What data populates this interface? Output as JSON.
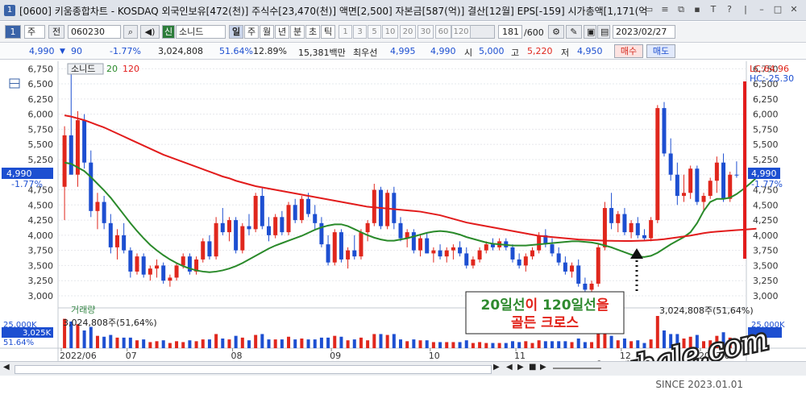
{
  "window": {
    "badge": "1",
    "title": "[0600] 키움종합차트 - KOSDAQ 외국인보유[472(천)] 주식수[23,470(천)] 액면[2,500] 자본금[587(억)] 결산[12월] EPS[-159] 시가총액[1,171(억",
    "buttons": [
      "▭",
      "≡",
      "⧉",
      "▪",
      "T",
      "?",
      "|",
      "–",
      "□",
      "✕"
    ]
  },
  "toolbar": {
    "badge": "1",
    "period_select": "주",
    "prev_label": "전",
    "stock_code": "060230",
    "market_tag": "신",
    "stock_name": "소니드",
    "timeframes": [
      "일",
      "주",
      "월",
      "년",
      "분",
      "초",
      "틱"
    ],
    "intervals": [
      "1",
      "3",
      "5",
      "10",
      "20",
      "30",
      "60",
      "120"
    ],
    "count": "181",
    "total": "/600",
    "date": "2023/02/27"
  },
  "quote": {
    "price": "4,990",
    "arrow": "▼",
    "change": "90",
    "change_pct": "-1.77%",
    "volume": "3,024,808",
    "ratio": "51.64%",
    "ratio2": "12.89%",
    "amount": "15,381백만",
    "best_label": "최우선",
    "best_ask": "4,995",
    "best_bid": "4,990",
    "open_label": "시",
    "open": "5,000",
    "high_label": "고",
    "high": "5,220",
    "low_label": "저",
    "low": "4,950",
    "buy_label": "매수",
    "sell_label": "매도"
  },
  "legend": {
    "name": "소니드",
    "ma20": "20",
    "ma120": "120"
  },
  "price_panel": {
    "lc_label": "LC:64.96",
    "hc_label": "HC:-25.30",
    "current_label": "4,990",
    "current_pct": "-1.77%",
    "volume_title": "거래량",
    "volume_text": "3,024,808주(51,64%)",
    "volume_text_right": "3,024,808주(51,64%)",
    "vol_left_box": "3,025K",
    "vol_left_pct": "51.64%",
    "vol_tick_top": "25,000K"
  },
  "annotation": {
    "line1_a": "20일선",
    "line1_b": "이 ",
    "line1_c": "120일선",
    "line1_d": "을",
    "line2": "골든 크로스"
  },
  "watermark": {
    "text": "i-whale.com",
    "since": "SINCE 2023.01.01"
  },
  "bottom_controls": [
    "◀",
    "▶",
    "◀",
    "▶",
    "■",
    "▶",
    "▶"
  ],
  "colors": {
    "up": "#e0271d",
    "down": "#1d4fd1",
    "ma20": "#2a8a2a",
    "ma120": "#e21c1c",
    "annotation_green": "#2f8a2f",
    "annotation_red": "#e2231a"
  },
  "chart_data": {
    "type": "candlestick",
    "title": "소니드",
    "y_ticks": [
      3000,
      3250,
      3500,
      3750,
      4000,
      4250,
      4500,
      4750,
      5000,
      5250,
      5500,
      5750,
      6000,
      6250,
      6500,
      6750
    ],
    "y_tick_labels": [
      "3,000",
      "3,250",
      "3,500",
      "3,750",
      "4,000",
      "4,250",
      "4,500",
      "4,750",
      "5,000",
      "5,250",
      "5,500",
      "5,750",
      "6,000",
      "6,250",
      "6,500",
      "6,750"
    ],
    "ylim": [
      2880,
      6820
    ],
    "x_tick_labels": [
      "2022/06",
      "07",
      "08",
      "09",
      "10",
      "11",
      "12",
      "2023/0"
    ],
    "series": [
      {
        "name": "20",
        "values": [
          5200,
          5180,
          5120,
          5060,
          4960,
          4850,
          4740,
          4620,
          4480,
          4340,
          4200,
          4070,
          3950,
          3840,
          3750,
          3670,
          3600,
          3540,
          3490,
          3450,
          3420,
          3400,
          3390,
          3400,
          3420,
          3450,
          3490,
          3540,
          3600,
          3660,
          3720,
          3780,
          3830,
          3870,
          3910,
          3950,
          3990,
          4040,
          4090,
          4130,
          4160,
          4180,
          4180,
          4150,
          4100,
          4050,
          4000,
          3960,
          3930,
          3910,
          3910,
          3930,
          3950,
          3980,
          4010,
          4040,
          4060,
          4070,
          4060,
          4040,
          4010,
          3970,
          3940,
          3910,
          3880,
          3860,
          3850,
          3840,
          3830,
          3830,
          3830,
          3840,
          3850,
          3860,
          3870,
          3880,
          3890,
          3900,
          3900,
          3890,
          3880,
          3860,
          3830,
          3800,
          3760,
          3720,
          3680,
          3650,
          3640,
          3660,
          3710,
          3780,
          3850,
          3910,
          3970,
          4050,
          4200,
          4400,
          4550,
          4600,
          4600,
          4620,
          4680,
          4760,
          4850,
          4950
        ]
      },
      {
        "name": "120",
        "values": [
          5980,
          5960,
          5930,
          5900,
          5860,
          5820,
          5780,
          5730,
          5680,
          5630,
          5580,
          5530,
          5480,
          5430,
          5380,
          5330,
          5290,
          5250,
          5210,
          5170,
          5130,
          5090,
          5050,
          5010,
          4970,
          4940,
          4900,
          4870,
          4840,
          4810,
          4790,
          4770,
          4750,
          4730,
          4710,
          4690,
          4670,
          4650,
          4630,
          4610,
          4590,
          4570,
          4550,
          4530,
          4510,
          4490,
          4470,
          4460,
          4450,
          4440,
          4430,
          4420,
          4410,
          4400,
          4390,
          4370,
          4350,
          4330,
          4300,
          4270,
          4240,
          4210,
          4190,
          4170,
          4150,
          4130,
          4110,
          4090,
          4070,
          4050,
          4030,
          4010,
          3990,
          3980,
          3970,
          3960,
          3950,
          3940,
          3930,
          3925,
          3920,
          3915,
          3910,
          3908,
          3906,
          3905,
          3905,
          3908,
          3912,
          3918,
          3925,
          3935,
          3950,
          3965,
          3980,
          3995,
          4015,
          4035,
          4050,
          4060,
          4068,
          4076,
          4084,
          4092,
          4100,
          4108
        ]
      }
    ],
    "ohlc": [
      [
        4800,
        5800,
        4250,
        5650
      ],
      [
        5650,
        6700,
        5300,
        5000
      ],
      [
        5000,
        6050,
        4800,
        5900
      ],
      [
        5900,
        6000,
        5100,
        5200
      ],
      [
        5200,
        5400,
        4300,
        4400
      ],
      [
        4400,
        4700,
        4100,
        4550
      ],
      [
        4550,
        4650,
        4100,
        4200
      ],
      [
        4200,
        4350,
        3700,
        3800
      ],
      [
        3800,
        4100,
        3600,
        4000
      ],
      [
        4000,
        4200,
        3700,
        3750
      ],
      [
        3750,
        3800,
        3300,
        3400
      ],
      [
        3400,
        3700,
        3350,
        3650
      ],
      [
        3650,
        3700,
        3300,
        3350
      ],
      [
        3350,
        3500,
        3250,
        3450
      ],
      [
        3450,
        3600,
        3300,
        3500
      ],
      [
        3500,
        3550,
        3200,
        3250
      ],
      [
        3250,
        3350,
        3150,
        3300
      ],
      [
        3300,
        3550,
        3250,
        3500
      ],
      [
        3500,
        3700,
        3450,
        3650
      ],
      [
        3650,
        3700,
        3350,
        3400
      ],
      [
        3400,
        3650,
        3350,
        3600
      ],
      [
        3600,
        3950,
        3550,
        3900
      ],
      [
        3900,
        4000,
        3600,
        3650
      ],
      [
        3650,
        4300,
        3600,
        4200
      ],
      [
        4200,
        4450,
        4000,
        4050
      ],
      [
        4050,
        4300,
        3900,
        4250
      ],
      [
        4250,
        4300,
        3700,
        3750
      ],
      [
        3750,
        4200,
        3700,
        4150
      ],
      [
        4150,
        4350,
        4000,
        4100
      ],
      [
        4100,
        4700,
        4050,
        4650
      ],
      [
        4650,
        4800,
        4100,
        4150
      ],
      [
        4150,
        4300,
        3900,
        4000
      ],
      [
        4000,
        4350,
        3950,
        4300
      ],
      [
        4300,
        4400,
        4000,
        4050
      ],
      [
        4050,
        4550,
        4000,
        4500
      ],
      [
        4500,
        4600,
        4200,
        4250
      ],
      [
        4250,
        4650,
        4200,
        4600
      ],
      [
        4600,
        4700,
        4300,
        4350
      ],
      [
        4350,
        4500,
        4100,
        4200
      ],
      [
        4200,
        4300,
        3800,
        3850
      ],
      [
        3850,
        4000,
        3500,
        3550
      ],
      [
        3550,
        4100,
        3500,
        4050
      ],
      [
        4050,
        4100,
        3550,
        3600
      ],
      [
        3600,
        3800,
        3450,
        3750
      ],
      [
        3750,
        4000,
        3600,
        3650
      ],
      [
        3650,
        4100,
        3600,
        4050
      ],
      [
        4050,
        4250,
        3900,
        4200
      ],
      [
        4200,
        4850,
        4150,
        4750
      ],
      [
        4750,
        4800,
        4100,
        4150
      ],
      [
        4150,
        4750,
        4100,
        4700
      ],
      [
        4700,
        4800,
        4100,
        4200
      ],
      [
        4200,
        4300,
        3900,
        3950
      ],
      [
        3950,
        4100,
        3800,
        4050
      ],
      [
        4050,
        4100,
        3700,
        3750
      ],
      [
        3750,
        4000,
        3650,
        3950
      ],
      [
        3950,
        4050,
        3700,
        3700
      ],
      [
        3700,
        3800,
        3550,
        3750
      ],
      [
        3750,
        3850,
        3600,
        3650
      ],
      [
        3650,
        3800,
        3550,
        3750
      ],
      [
        3750,
        3850,
        3600,
        3800
      ],
      [
        3800,
        3900,
        3650,
        3700
      ],
      [
        3700,
        3800,
        3450,
        3500
      ],
      [
        3500,
        3650,
        3450,
        3600
      ],
      [
        3600,
        3800,
        3550,
        3750
      ],
      [
        3750,
        3900,
        3700,
        3850
      ],
      [
        3850,
        3950,
        3750,
        3800
      ],
      [
        3800,
        3950,
        3750,
        3900
      ],
      [
        3900,
        3950,
        3750,
        3800
      ],
      [
        3800,
        3850,
        3550,
        3600
      ],
      [
        3600,
        3700,
        3450,
        3500
      ],
      [
        3500,
        3700,
        3400,
        3650
      ],
      [
        3650,
        3800,
        3600,
        3750
      ],
      [
        3750,
        4050,
        3700,
        4000
      ],
      [
        4000,
        4100,
        3800,
        3850
      ],
      [
        3850,
        3950,
        3650,
        3700
      ],
      [
        3700,
        3800,
        3500,
        3550
      ],
      [
        3550,
        3650,
        3350,
        3400
      ],
      [
        3400,
        3550,
        3300,
        3500
      ],
      [
        3500,
        3600,
        3150,
        3200
      ],
      [
        3200,
        3300,
        3050,
        3100
      ],
      [
        3100,
        3250,
        3000,
        3200
      ],
      [
        3200,
        3850,
        3150,
        3800
      ],
      [
        3800,
        4550,
        3750,
        4450
      ],
      [
        4450,
        4700,
        4100,
        4200
      ],
      [
        4200,
        4400,
        4050,
        4350
      ],
      [
        4350,
        4450,
        4000,
        4050
      ],
      [
        4050,
        4250,
        3950,
        4200
      ],
      [
        4200,
        4300,
        3950,
        4000
      ],
      [
        4000,
        4100,
        3900,
        3950
      ],
      [
        3950,
        4300,
        3900,
        4250
      ],
      [
        4250,
        6150,
        4200,
        6100
      ],
      [
        6100,
        6200,
        5300,
        5350
      ],
      [
        5350,
        5600,
        4900,
        5000
      ],
      [
        5000,
        5200,
        4500,
        4650
      ],
      [
        4650,
        5000,
        4550,
        4700
      ],
      [
        4700,
        5150,
        4600,
        5100
      ],
      [
        5100,
        5150,
        4500,
        4550
      ],
      [
        4550,
        4700,
        4400,
        4650
      ],
      [
        4650,
        4950,
        4600,
        4900
      ],
      [
        4900,
        5300,
        4700,
        5200
      ],
      [
        5200,
        5350,
        4550,
        4600
      ],
      [
        4600,
        5050,
        4550,
        5000
      ],
      [
        5000,
        5220,
        4950,
        4990
      ]
    ],
    "volume_last": "3,024,808주(51,64%)"
  }
}
